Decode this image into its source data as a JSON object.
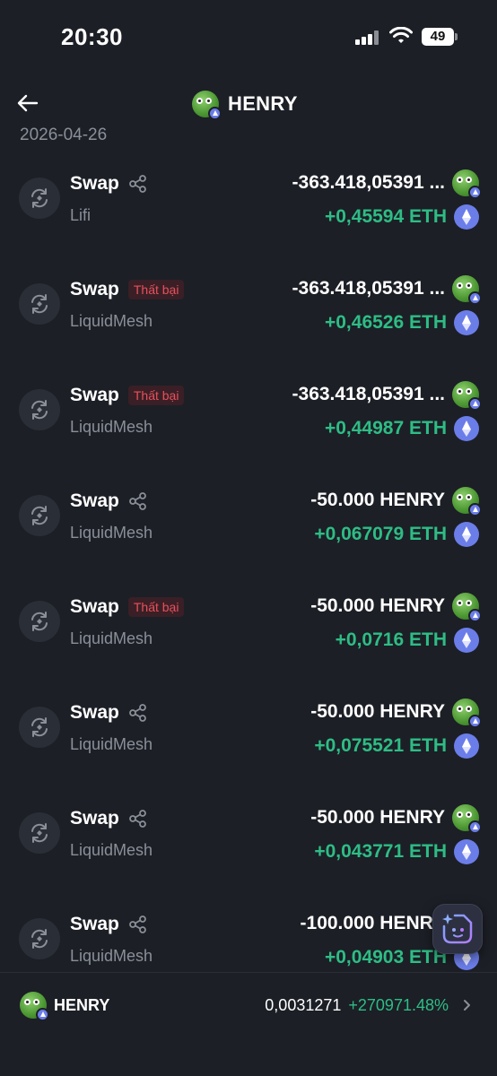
{
  "status_bar": {
    "time": "20:30",
    "battery": "49"
  },
  "header": {
    "title": "HENRY"
  },
  "date_label": "2026-04-26",
  "transactions": [
    {
      "title": "Swap",
      "failed": false,
      "badge": "",
      "provider": "Lifi",
      "sent": "-363.418,05391 ...",
      "received": "+0,45594 ETH"
    },
    {
      "title": "Swap",
      "failed": true,
      "badge": "Thất bại",
      "provider": "LiquidMesh",
      "sent": "-363.418,05391 ...",
      "received": "+0,46526 ETH"
    },
    {
      "title": "Swap",
      "failed": true,
      "badge": "Thất bại",
      "provider": "LiquidMesh",
      "sent": "-363.418,05391 ...",
      "received": "+0,44987 ETH"
    },
    {
      "title": "Swap",
      "failed": false,
      "badge": "",
      "provider": "LiquidMesh",
      "sent": "-50.000 HENRY",
      "received": "+0,067079 ETH"
    },
    {
      "title": "Swap",
      "failed": true,
      "badge": "Thất bại",
      "provider": "LiquidMesh",
      "sent": "-50.000 HENRY",
      "received": "+0,0716 ETH"
    },
    {
      "title": "Swap",
      "failed": false,
      "badge": "",
      "provider": "LiquidMesh",
      "sent": "-50.000 HENRY",
      "received": "+0,075521 ETH"
    },
    {
      "title": "Swap",
      "failed": false,
      "badge": "",
      "provider": "LiquidMesh",
      "sent": "-50.000 HENRY",
      "received": "+0,043771 ETH"
    },
    {
      "title": "Swap",
      "failed": false,
      "badge": "",
      "provider": "LiquidMesh",
      "sent": "-100.000 HENRY",
      "received": "+0,04903 ETH"
    }
  ],
  "footer": {
    "token": "HENRY",
    "price": "0,0031271",
    "change": "+270971.48%"
  },
  "colors": {
    "background": "#1c1f26",
    "positive": "#2ebd85",
    "failed": "#e8505b",
    "eth": "#6b7de8"
  }
}
